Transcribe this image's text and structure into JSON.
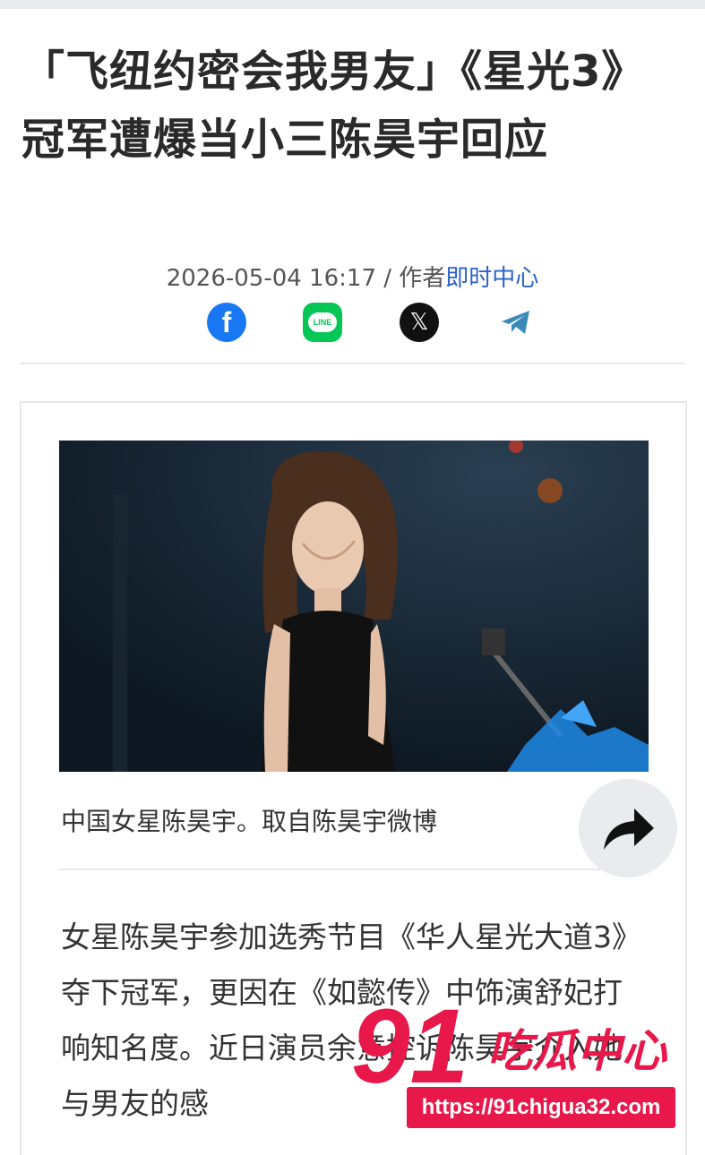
{
  "article": {
    "title": "「飞纽约密会我男友」《星光3》冠军遭爆当小三陈昊宇回应",
    "date": "2026-05-04 16:17",
    "separator": " / ",
    "author_prefix": "作者",
    "author": "即时中心"
  },
  "share": {
    "icons": [
      "facebook-icon",
      "line-icon",
      "x-icon",
      "telegram-icon"
    ],
    "line_text": "LINE",
    "colors": {
      "facebook": "#1877f2",
      "line": "#06c755",
      "x": "#111111",
      "telegram": "#3b8bb8"
    }
  },
  "media": {
    "caption": "中国女星陈昊宇。取自陈昊宇微博"
  },
  "body": {
    "paragraph": "女星陈昊宇参加选秀节目《华人星光大道3》夺下冠军，更因在《如懿传》中饰演舒妃打响知名度。近日演员余意控诉陈昊宇介入她与男友的感"
  },
  "watermark": {
    "number": "91",
    "title": "吃瓜中心",
    "url": "https://91chigua32.com"
  },
  "colors": {
    "accent": "#2a62c9",
    "watermark": "#e8184a"
  }
}
